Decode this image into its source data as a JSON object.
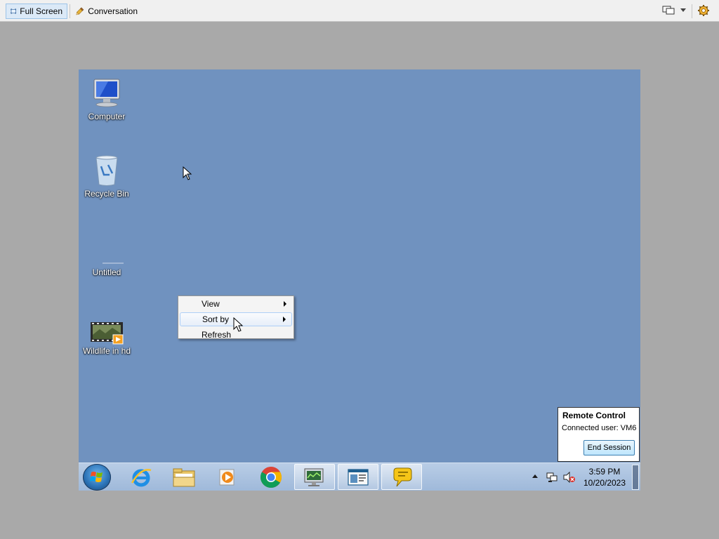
{
  "toolbar": {
    "fullscreen_label": "Full Screen",
    "conversation_label": "Conversation"
  },
  "desktop": {
    "icons": [
      {
        "label": "Computer",
        "icon": "computer-icon"
      },
      {
        "label": "Recycle Bin",
        "icon": "recycle-bin-icon"
      },
      {
        "label": "Untitled",
        "icon": "blank-file-icon"
      },
      {
        "label": "Wildlife in hd",
        "icon": "video-file-icon"
      }
    ]
  },
  "context_menu": {
    "items": [
      {
        "label": "View",
        "submenu": true
      },
      {
        "label": "Sort by",
        "submenu": true,
        "highlighted": true
      },
      {
        "label": "Refresh",
        "submenu": false
      }
    ]
  },
  "remote_control": {
    "title": "Remote Control",
    "connected_user": "Connected user:  VM6",
    "end_session_label": "End Session"
  },
  "taskbar": {
    "apps": [
      "internet-explorer-icon",
      "windows-explorer-icon",
      "media-player-icon",
      "chrome-icon",
      "remote-monitor-icon",
      "news-window-icon",
      "chat-bubble-icon"
    ],
    "time": "3:59 PM",
    "date": "10/20/2023"
  },
  "colors": {
    "desktop_bg": "#7092bf",
    "outer_bg": "#a9a9a9"
  }
}
